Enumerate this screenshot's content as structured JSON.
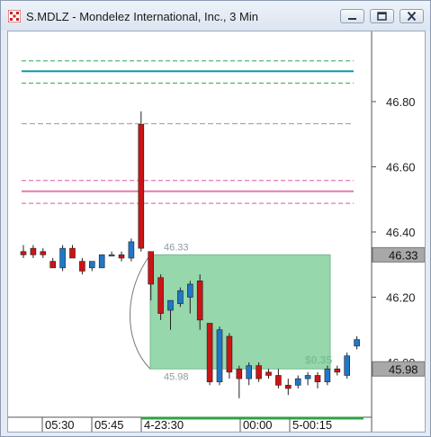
{
  "window": {
    "title": "S.MDLZ - Mondelez International, Inc., 3 Min",
    "controls": [
      "minimize",
      "restore",
      "close"
    ]
  },
  "chart_data": {
    "type": "candlestick",
    "y_axis": {
      "ticks": [
        "46.80",
        "46.60",
        "46.40",
        "46.20",
        "46.00"
      ],
      "tick_values": [
        46.8,
        46.6,
        46.4,
        46.2,
        46.0
      ],
      "ylim": [
        45.88,
        46.94
      ],
      "price_tags": [
        {
          "label": "46.33",
          "value": 46.33
        },
        {
          "label": "45.98",
          "value": 45.98
        }
      ]
    },
    "x_axis": {
      "ticks": [
        "05:30",
        "05:45",
        "4-23:30",
        "00:00",
        "5-00:15"
      ]
    },
    "colors": {
      "up": "#1f77c8",
      "down": "#cc1414",
      "zone_fill": "#8ed4a4",
      "zone_text": "#7bbf92",
      "teal_line": "#0e9aa8",
      "green_dash": "#2aa84a",
      "gray_dash": "#aa9090",
      "pink_line": "#e879b6",
      "pink_dash": "#e05aa0"
    },
    "horizontal_lines": [
      {
        "style": "dashed",
        "color": "green",
        "value": 46.925
      },
      {
        "style": "solid",
        "color": "teal",
        "value": 46.893
      },
      {
        "style": "dashed",
        "color": "green",
        "value": 46.857
      },
      {
        "style": "dashed",
        "color": "gray",
        "value": 46.732
      },
      {
        "style": "dashed",
        "color": "pink",
        "value": 46.558
      },
      {
        "style": "solid",
        "color": "pink",
        "value": 46.525
      },
      {
        "style": "dashed",
        "color": "pink",
        "value": 46.488
      }
    ],
    "zone": {
      "top": 46.33,
      "bottom": 45.98,
      "top_label": "46.33",
      "bottom_label": "45.98",
      "profit_label": "$0.35"
    },
    "candles": [
      {
        "o": 46.34,
        "h": 46.36,
        "l": 46.32,
        "c": 46.33
      },
      {
        "o": 46.35,
        "h": 46.36,
        "l": 46.32,
        "c": 46.33
      },
      {
        "o": 46.34,
        "h": 46.35,
        "l": 46.32,
        "c": 46.33
      },
      {
        "o": 46.31,
        "h": 46.32,
        "l": 46.29,
        "c": 46.29
      },
      {
        "o": 46.29,
        "h": 46.36,
        "l": 46.28,
        "c": 46.35
      },
      {
        "o": 46.35,
        "h": 46.36,
        "l": 46.32,
        "c": 46.32
      },
      {
        "o": 46.31,
        "h": 46.32,
        "l": 46.27,
        "c": 46.28
      },
      {
        "o": 46.29,
        "h": 46.31,
        "l": 46.28,
        "c": 46.31
      },
      {
        "o": 46.29,
        "h": 46.33,
        "l": 46.29,
        "c": 46.33
      },
      {
        "o": 46.33,
        "h": 46.34,
        "l": 46.33,
        "c": 46.33
      },
      {
        "o": 46.33,
        "h": 46.34,
        "l": 46.31,
        "c": 46.32
      },
      {
        "o": 46.32,
        "h": 46.38,
        "l": 46.31,
        "c": 46.37
      },
      {
        "o": 46.73,
        "h": 46.77,
        "l": 46.34,
        "c": 46.35
      },
      {
        "o": 46.34,
        "h": 46.34,
        "l": 46.19,
        "c": 46.24
      },
      {
        "o": 46.26,
        "h": 46.27,
        "l": 46.13,
        "c": 46.15
      },
      {
        "o": 46.16,
        "h": 46.19,
        "l": 46.1,
        "c": 46.19
      },
      {
        "o": 46.18,
        "h": 46.23,
        "l": 46.17,
        "c": 46.22
      },
      {
        "o": 46.2,
        "h": 46.25,
        "l": 46.15,
        "c": 46.24
      },
      {
        "o": 46.25,
        "h": 46.27,
        "l": 46.1,
        "c": 46.13
      },
      {
        "o": 46.12,
        "h": 46.12,
        "l": 45.93,
        "c": 45.94
      },
      {
        "o": 45.94,
        "h": 46.11,
        "l": 45.93,
        "c": 46.1
      },
      {
        "o": 46.08,
        "h": 46.09,
        "l": 45.95,
        "c": 45.97
      },
      {
        "o": 45.98,
        "h": 45.99,
        "l": 45.89,
        "c": 45.95
      },
      {
        "o": 45.95,
        "h": 46.0,
        "l": 45.93,
        "c": 45.99
      },
      {
        "o": 45.99,
        "h": 46.0,
        "l": 45.94,
        "c": 45.95
      },
      {
        "o": 45.97,
        "h": 45.98,
        "l": 45.95,
        "c": 45.96
      },
      {
        "o": 45.96,
        "h": 45.98,
        "l": 45.92,
        "c": 45.93
      },
      {
        "o": 45.93,
        "h": 45.95,
        "l": 45.9,
        "c": 45.92
      },
      {
        "o": 45.93,
        "h": 45.96,
        "l": 45.92,
        "c": 45.95
      },
      {
        "o": 45.95,
        "h": 45.97,
        "l": 45.93,
        "c": 45.96
      },
      {
        "o": 45.96,
        "h": 45.97,
        "l": 45.92,
        "c": 45.94
      },
      {
        "o": 45.94,
        "h": 45.99,
        "l": 45.93,
        "c": 45.98
      },
      {
        "o": 45.98,
        "h": 45.99,
        "l": 45.96,
        "c": 45.97
      },
      {
        "o": 45.96,
        "h": 46.03,
        "l": 45.95,
        "c": 46.02
      },
      {
        "o": 46.05,
        "h": 46.08,
        "l": 46.04,
        "c": 46.07
      }
    ]
  }
}
